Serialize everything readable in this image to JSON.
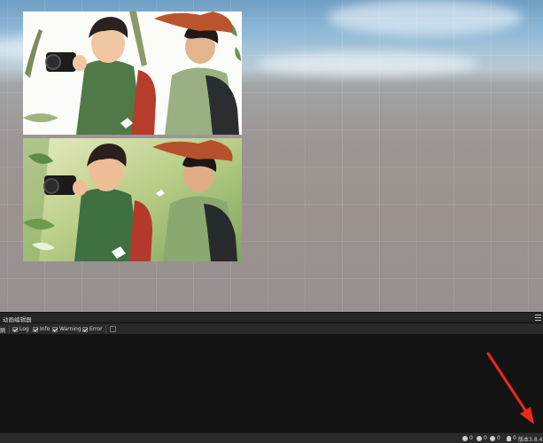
{
  "panel": {
    "title": "动画编辑器"
  },
  "toolbar": {
    "clear_label": "刷",
    "filters": [
      {
        "label": "Log",
        "checked": true
      },
      {
        "label": "Info",
        "checked": true
      },
      {
        "label": "Warning",
        "checked": true
      },
      {
        "label": "Error",
        "checked": true
      }
    ]
  },
  "statusbar": {
    "info_count": "0",
    "warning_count": "0",
    "error_count": "0",
    "notify_count": "0",
    "version": "版本3.8.4"
  },
  "colors": {
    "annotation_arrow": "#e8291c",
    "console_bg": "#131313",
    "panel_bg": "#252525"
  },
  "icons": [
    "panel-menu-icon",
    "checkbox-icon",
    "info-icon",
    "warning-icon",
    "error-icon",
    "bell-icon",
    "red-arrow-annotation"
  ]
}
